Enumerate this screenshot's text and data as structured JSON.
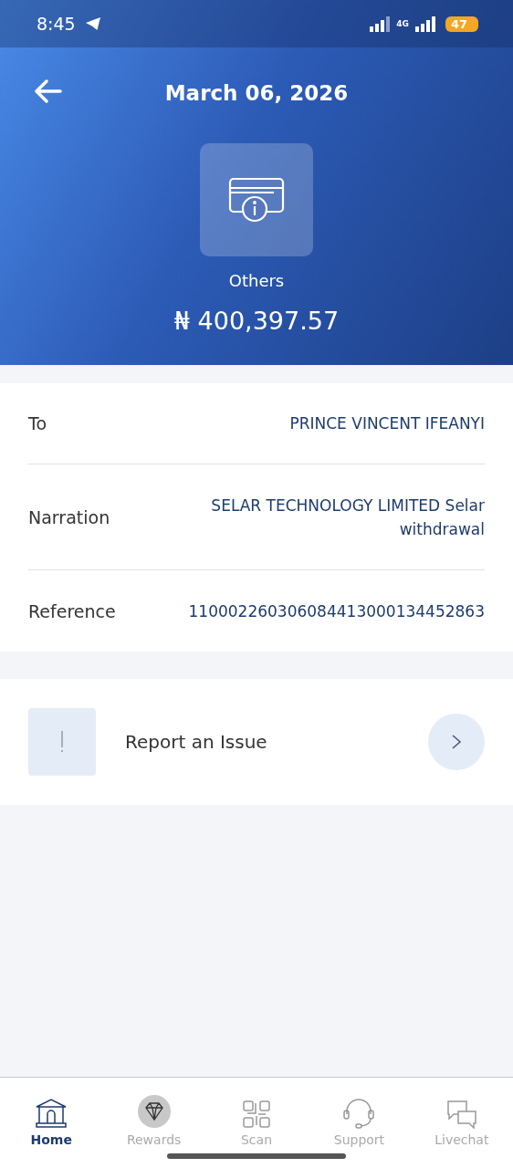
{
  "status_bar": {
    "time": "8:45",
    "network": "4G",
    "battery": "47"
  },
  "header": {
    "title": "March 06, 2026",
    "category": "Others",
    "amount": "₦ 400,397.57"
  },
  "details": [
    {
      "label": "To",
      "value": "PRINCE VINCENT IFEANYI"
    },
    {
      "label": "Narration",
      "value": "SELAR TECHNOLOGY LIMITED Selar withdrawal"
    },
    {
      "label": "Reference",
      "value": "110002260306084413000134452863"
    }
  ],
  "report": {
    "label": "Report an Issue"
  },
  "nav": [
    {
      "kind": "home",
      "label": "Home",
      "selected": true
    },
    {
      "kind": "rewards",
      "label": "Rewards",
      "selected": false
    },
    {
      "kind": "scan",
      "label": "Scan",
      "selected": false
    },
    {
      "kind": "support",
      "label": "Support",
      "selected": false
    },
    {
      "kind": "livechat",
      "label": "Livechat",
      "selected": false
    }
  ]
}
